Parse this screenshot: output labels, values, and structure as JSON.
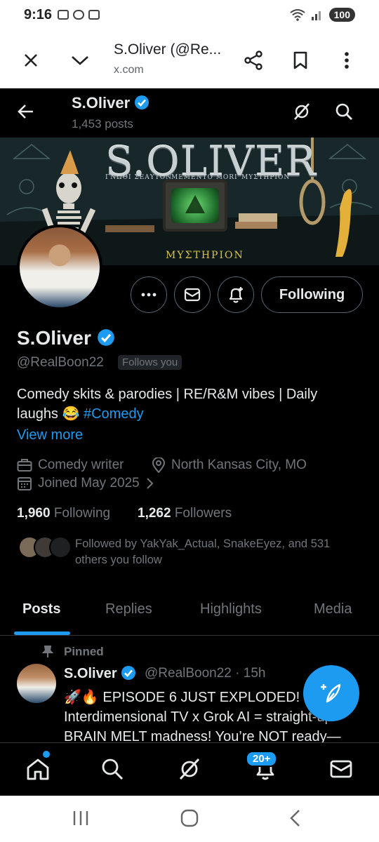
{
  "status_bar": {
    "time": "9:16",
    "battery": "100"
  },
  "browser": {
    "title": "S.Oliver (@Re...",
    "url": "x.com"
  },
  "header": {
    "name": "S.Oliver",
    "posts": "1,453 posts"
  },
  "banner": {
    "title": "S.OLIVER",
    "sub_left": "ΓΝΩΘΙ ΣΕΑΥΤΟΝ",
    "sub_mid": "MEMENTO MORI",
    "sub_right": "ΜΥΣΤΗΡΙΟΝ",
    "greek": "ΜΥΣΤΗΡΙΟΝ"
  },
  "profile": {
    "following_button": "Following",
    "name": "S.Oliver",
    "handle": "@RealBoon22",
    "follows_you": "Follows you",
    "bio_line1": "Comedy skits & parodies | RE/R&M vibes | Daily",
    "bio_line2": "laughs 😂",
    "hashtag": "#Comedy",
    "view_more": "View more",
    "job": "Comedy writer",
    "location": "North Kansas City, MO",
    "joined": "Joined May 2025",
    "following_count": "1,960",
    "following_label": "Following",
    "followers_count": "1,262",
    "followers_label": "Followers",
    "followed_by": "Followed by YakYak_Actual, SnakeEyez, and 531 others you follow"
  },
  "tabs": [
    {
      "label": "Posts",
      "active": true
    },
    {
      "label": "Replies"
    },
    {
      "label": "Highlights"
    },
    {
      "label": "Media"
    }
  ],
  "post": {
    "pinned": "Pinned",
    "name": "S.Oliver",
    "meta": "@RealBoon22 · 15h",
    "text_line1": "🚀🔥 EPISODE 6 JUST EXPLODED!",
    "text_line2": "Interdimensional TV x Grok AI = straight-up",
    "text_line3": "BRAIN MELT madness! You’re NOT ready—"
  },
  "nav": {
    "notifications_badge": "20+"
  },
  "colors": {
    "accent": "#1d9bf0",
    "background": "#000000",
    "muted": "#71767b",
    "text": "#e7e9ea"
  }
}
